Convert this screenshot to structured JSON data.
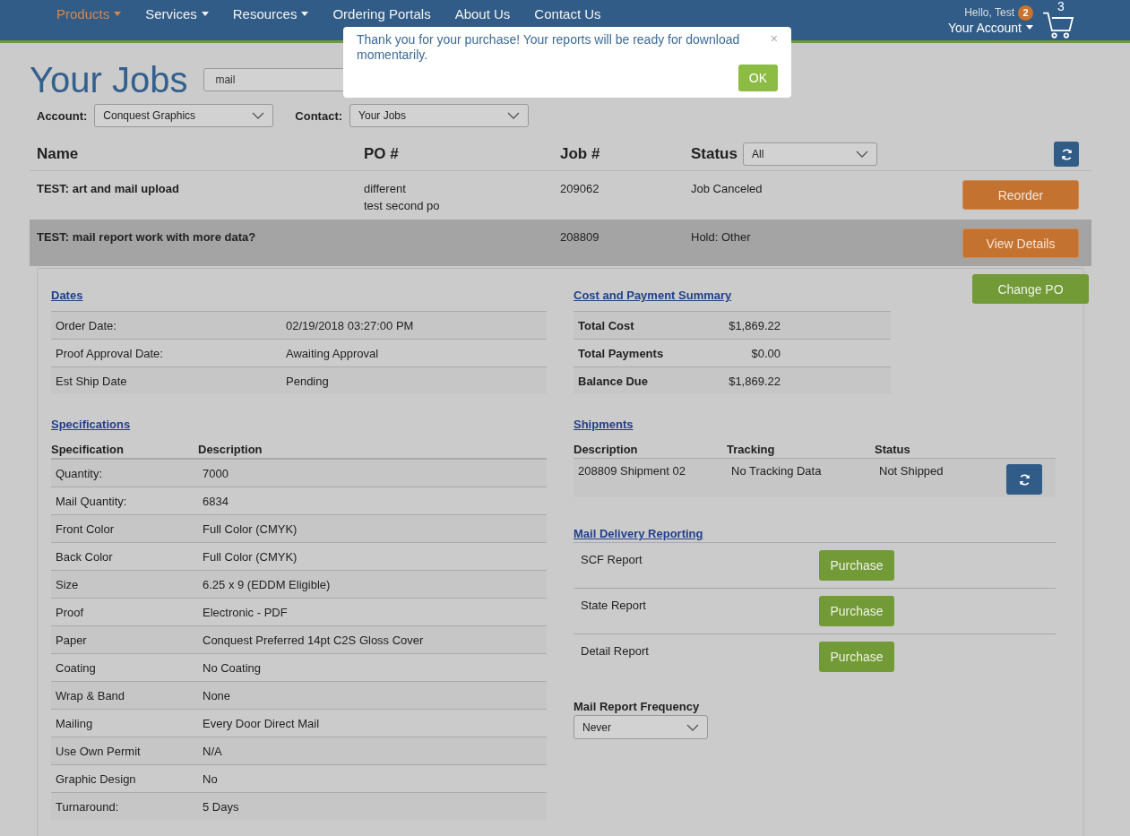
{
  "nav": {
    "items": [
      {
        "label": "Products",
        "selected": true,
        "dropdown": true
      },
      {
        "label": "Services",
        "selected": false,
        "dropdown": true
      },
      {
        "label": "Resources",
        "selected": false,
        "dropdown": true
      },
      {
        "label": "Ordering Portals",
        "selected": false,
        "dropdown": false
      },
      {
        "label": "About Us",
        "selected": false,
        "dropdown": false
      },
      {
        "label": "Contact Us",
        "selected": false,
        "dropdown": false
      }
    ],
    "greeting": "Hello, Test",
    "badge": "2",
    "account": "Your Account",
    "cart_count": "3"
  },
  "modal": {
    "message": "Thank you for your purchase! Your reports will be ready for download momentarily.",
    "close": "×",
    "ok": "OK"
  },
  "page": {
    "title": "Your Jobs",
    "search": {
      "value": "mail"
    },
    "account_label": "Account:",
    "account_value": "Conquest Graphics",
    "contact_label": "Contact:",
    "contact_value": "Your Jobs"
  },
  "table": {
    "columns": [
      "Name",
      "PO #",
      "Job #",
      "Status"
    ],
    "status_filter": "All",
    "rows": [
      {
        "name": "TEST: art and mail upload",
        "po": [
          "different",
          "test second po"
        ],
        "job": "209062",
        "status": "Job Canceled",
        "action": "Reorder",
        "selected": false
      },
      {
        "name": "TEST: mail report work with more data?",
        "po": [],
        "job": "208809",
        "status": "Hold: Other",
        "action": "View Details",
        "selected": true
      }
    ]
  },
  "details": {
    "change_po": "Change PO",
    "dates": {
      "heading": "Dates",
      "rows": [
        {
          "label": "Order Date:",
          "value": "02/19/2018 03:27:00 PM"
        },
        {
          "label": "Proof Approval Date:",
          "value": "Awaiting Approval"
        },
        {
          "label": "Est Ship Date",
          "value": "Pending"
        }
      ]
    },
    "specs": {
      "heading": "Specifications",
      "columns": [
        "Specification",
        "Description"
      ],
      "rows": [
        {
          "label": "Quantity:",
          "value": "7000"
        },
        {
          "label": "Mail Quantity:",
          "value": "6834"
        },
        {
          "label": "Front Color",
          "value": "Full Color (CMYK)"
        },
        {
          "label": "Back Color",
          "value": "Full Color (CMYK)"
        },
        {
          "label": "Size",
          "value": "6.25 x 9 (EDDM Eligible)"
        },
        {
          "label": "Proof",
          "value": "Electronic - PDF"
        },
        {
          "label": "Paper",
          "value": "Conquest Preferred 14pt C2S Gloss Cover"
        },
        {
          "label": "Coating",
          "value": "No Coating"
        },
        {
          "label": "Wrap & Band",
          "value": "None"
        },
        {
          "label": "Mailing",
          "value": "Every Door Direct Mail"
        },
        {
          "label": "Use Own Permit",
          "value": "N/A"
        },
        {
          "label": "Graphic Design",
          "value": "No"
        },
        {
          "label": "Turnaround:",
          "value": "5 Days"
        }
      ]
    },
    "cost": {
      "heading": "Cost and Payment Summary",
      "rows": [
        {
          "label": "Total Cost",
          "value": "$1,869.22"
        },
        {
          "label": "Total Payments",
          "value": "$0.00"
        },
        {
          "label": "Balance Due",
          "value": "$1,869.22"
        }
      ]
    },
    "shipments": {
      "heading": "Shipments",
      "columns": [
        "Description",
        "Tracking",
        "Status"
      ],
      "rows": [
        {
          "description": "208809 Shipment 02",
          "tracking": "No Tracking Data",
          "status": "Not Shipped"
        }
      ]
    },
    "reporting": {
      "heading": "Mail Delivery Reporting",
      "rows": [
        {
          "label": "SCF Report",
          "button": "Purchase"
        },
        {
          "label": "State Report",
          "button": "Purchase"
        },
        {
          "label": "Detail Report",
          "button": "Purchase"
        }
      ],
      "frequency_label": "Mail Report Frequency",
      "frequency_value": "Never"
    }
  }
}
